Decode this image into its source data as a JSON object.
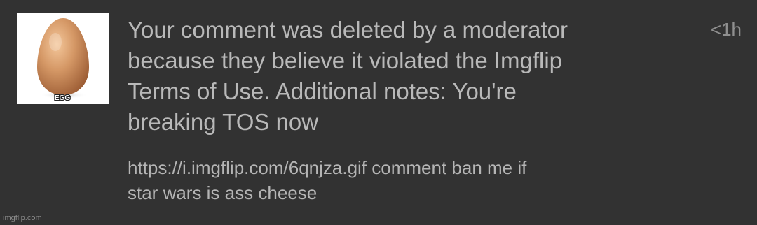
{
  "notification": {
    "thumbnail": {
      "icon": "egg-image",
      "caption": "EGG"
    },
    "message": "Your comment was deleted by a moderator\nbecause they believe it violated the Imgflip\nTerms of Use. Additional notes: You're\nbreaking TOS now",
    "timestamp": "<1h",
    "comment": "https://i.imgflip.com/6qnjza.gif comment ban me if\nstar wars is ass cheese"
  },
  "watermark": "imgflip.com",
  "colors": {
    "background": "#323232",
    "text": "#b9b9b9",
    "muted": "#8f8f8f",
    "egg": "#c98a5a"
  }
}
